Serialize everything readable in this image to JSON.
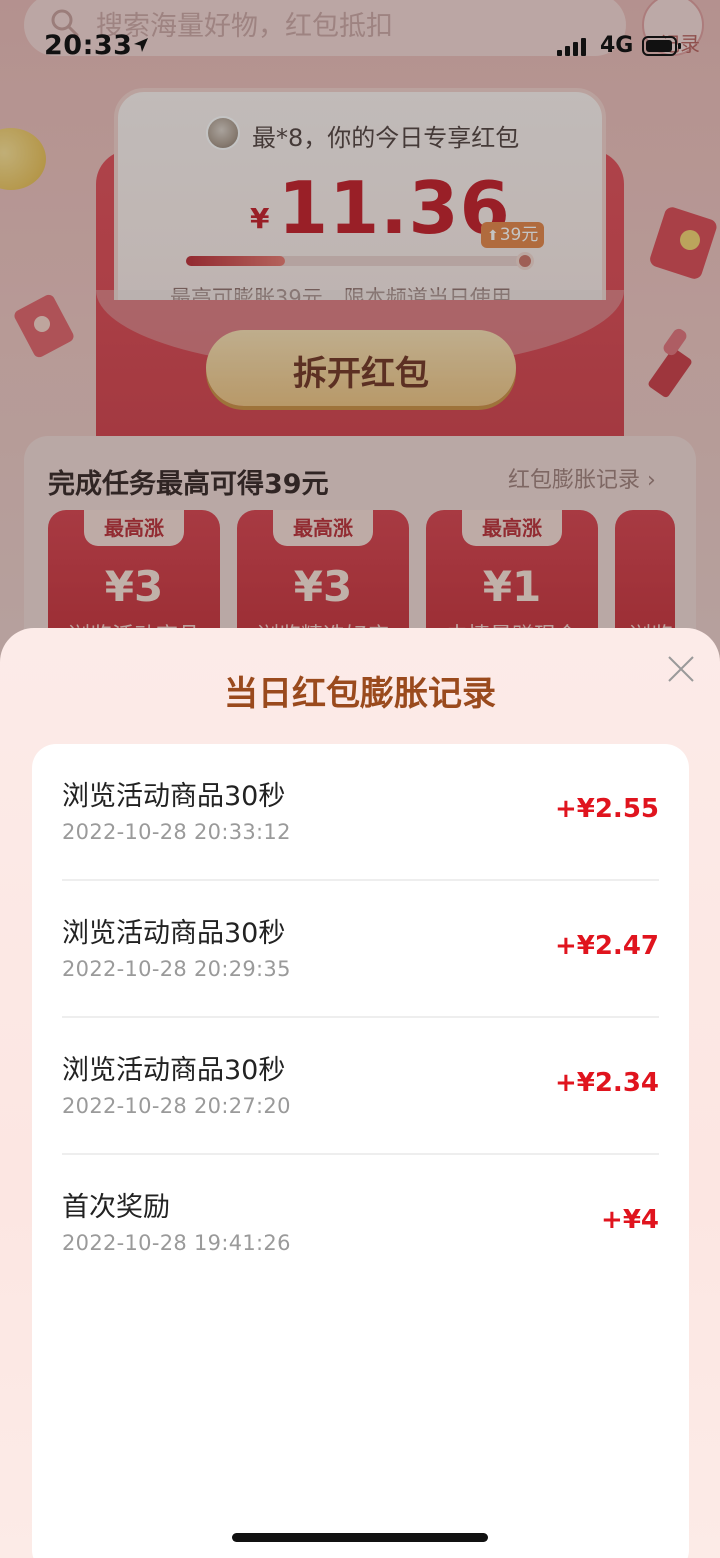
{
  "status_bar": {
    "time": "20:33",
    "network": "4G"
  },
  "search": {
    "placeholder": "搜索海量好物，红包抵扣",
    "record_label": "记录"
  },
  "redpacket": {
    "greeting": "最*8，你的今日专享红包",
    "currency": "¥",
    "amount": "11.36",
    "cap_badge": "39元",
    "progress_fraction": 0.29,
    "info": "最高可膨胀39元，限本频道当日使用",
    "open_button": "拆开红包"
  },
  "tasks": {
    "title": "完成任务最高可得39元",
    "link": "红包膨胀记录 ›",
    "items": [
      {
        "tab": "最高涨",
        "reward": "¥3",
        "name": "浏览活动商品"
      },
      {
        "tab": "最高涨",
        "reward": "¥3",
        "name": "浏览精选好店"
      },
      {
        "tab": "最高涨",
        "reward": "¥1",
        "name": "去情景赚现金"
      },
      {
        "tab": "",
        "reward": "",
        "name": "浏览"
      }
    ]
  },
  "sheet": {
    "title": "当日红包膨胀记录",
    "records": [
      {
        "title": "浏览活动商品30秒",
        "time": "2022-10-28 20:33:12",
        "amount": "+¥2.55"
      },
      {
        "title": "浏览活动商品30秒",
        "time": "2022-10-28 20:29:35",
        "amount": "+¥2.47"
      },
      {
        "title": "浏览活动商品30秒",
        "time": "2022-10-28 20:27:20",
        "amount": "+¥2.34"
      },
      {
        "title": "首次奖励",
        "time": "2022-10-28 19:41:26",
        "amount": "+¥4"
      }
    ]
  },
  "colors": {
    "accent_red": "#e0141e",
    "sheet_title": "#9a4a1d",
    "button_gold": "#eec27d"
  },
  "icons": [
    "search-icon",
    "location-icon",
    "signal-icon",
    "battery-icon",
    "close-icon",
    "record-icon"
  ]
}
